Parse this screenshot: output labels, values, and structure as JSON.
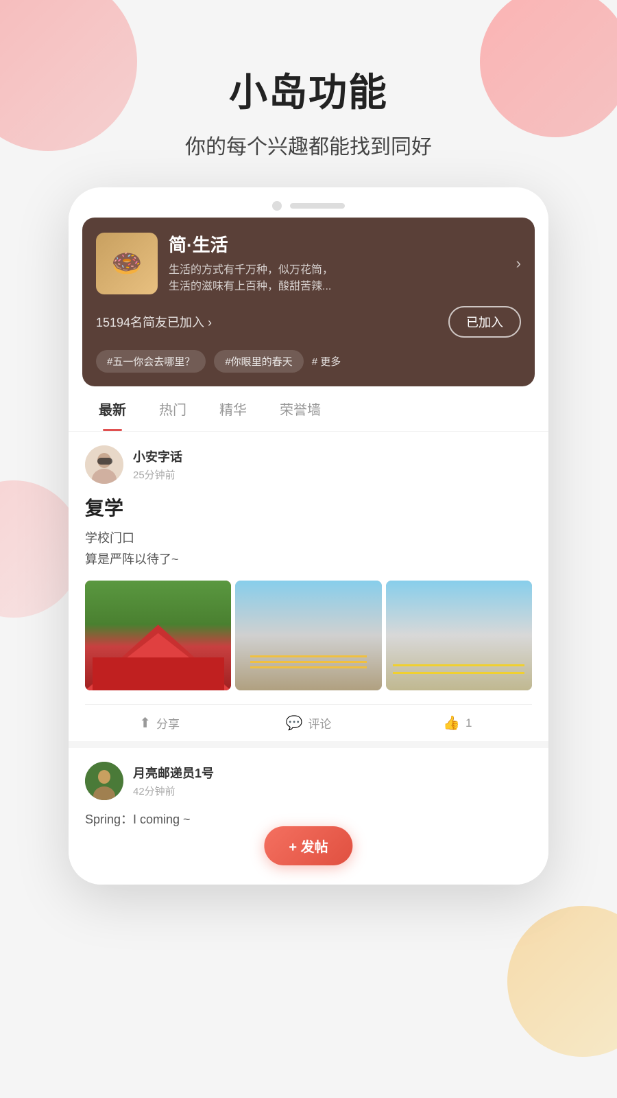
{
  "page": {
    "bg_circles": [
      "top-left",
      "top-right",
      "mid-left",
      "bottom-right"
    ]
  },
  "header": {
    "title": "小岛功能",
    "subtitle": "你的每个兴趣都能找到同好"
  },
  "island_card": {
    "avatar_emoji": "🍩",
    "name": "简·生活",
    "desc_line1": "生活的方式有千万种，似万花筒，",
    "desc_line2": "生活的滋味有上百种，酸甜苦辣...",
    "members_text": "15194名简友已加入 ›",
    "join_button": "已加入",
    "tags": [
      "#五一你会去哪里？",
      "#你眼里的春天"
    ],
    "more_label": "# 更多"
  },
  "tabs": [
    {
      "label": "最新",
      "active": true
    },
    {
      "label": "热门",
      "active": false
    },
    {
      "label": "精华",
      "active": false
    },
    {
      "label": "荣誉墙",
      "active": false
    }
  ],
  "post1": {
    "username": "小安字话",
    "time": "25分钟前",
    "title": "复学",
    "content_line1": "学校门口",
    "content_line2": "算是严阵以待了~",
    "images": [
      "img1",
      "img2",
      "img3"
    ],
    "actions": {
      "share": "分享",
      "comment": "评论",
      "like": "1"
    }
  },
  "post2": {
    "username": "月亮邮递员1号",
    "time": "42分钟前",
    "content": "Spring：I coming ~"
  },
  "fab": {
    "label": "+ 发帖"
  }
}
